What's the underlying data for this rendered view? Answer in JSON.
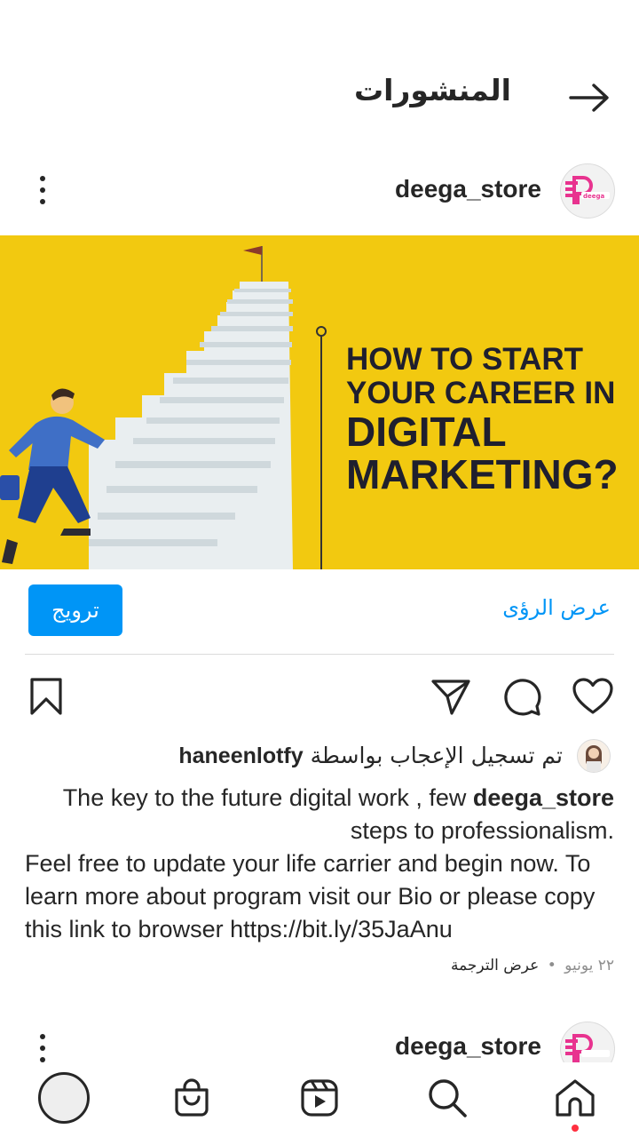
{
  "header": {
    "title": "المنشورات",
    "back_icon": "arrow-right-icon"
  },
  "post": {
    "username": "deega_store",
    "avatar_text": "deega_store",
    "image": {
      "line1": "HOW TO START",
      "line2": "YOUR CAREER IN",
      "line3": "DIGITAL",
      "line4": "MARKETING?"
    },
    "promote_label": "ترويج",
    "insights_label": "عرض الرؤى",
    "likes": {
      "prefix": "تم تسجيل الإعجاب بواسطة",
      "user": "haneenlotfy"
    },
    "caption": {
      "username": "deega_store",
      "line1": "The key to the future digital work , few",
      "line2": "steps to professionalism.",
      "body": "Feel free to update your life carrier and begin now. To learn more about program visit our Bio or please copy this link to browser https://bit.ly/35JaAnu"
    },
    "date": "٢٢ يونيو",
    "separator": "•",
    "translate_label": "عرض الترجمة"
  },
  "next_post": {
    "username": "deega_store"
  },
  "icons": {
    "like": "heart-icon",
    "comment": "comment-icon",
    "share": "send-icon",
    "save": "bookmark-icon",
    "more": "more-vertical-icon"
  },
  "bottom_nav": [
    "home-icon",
    "search-icon",
    "reels-icon",
    "shop-icon",
    "profile-avatar"
  ],
  "colors": {
    "accent": "#0095f6",
    "image_bg": "#f2c910",
    "notification_dot": "#ff3040"
  }
}
